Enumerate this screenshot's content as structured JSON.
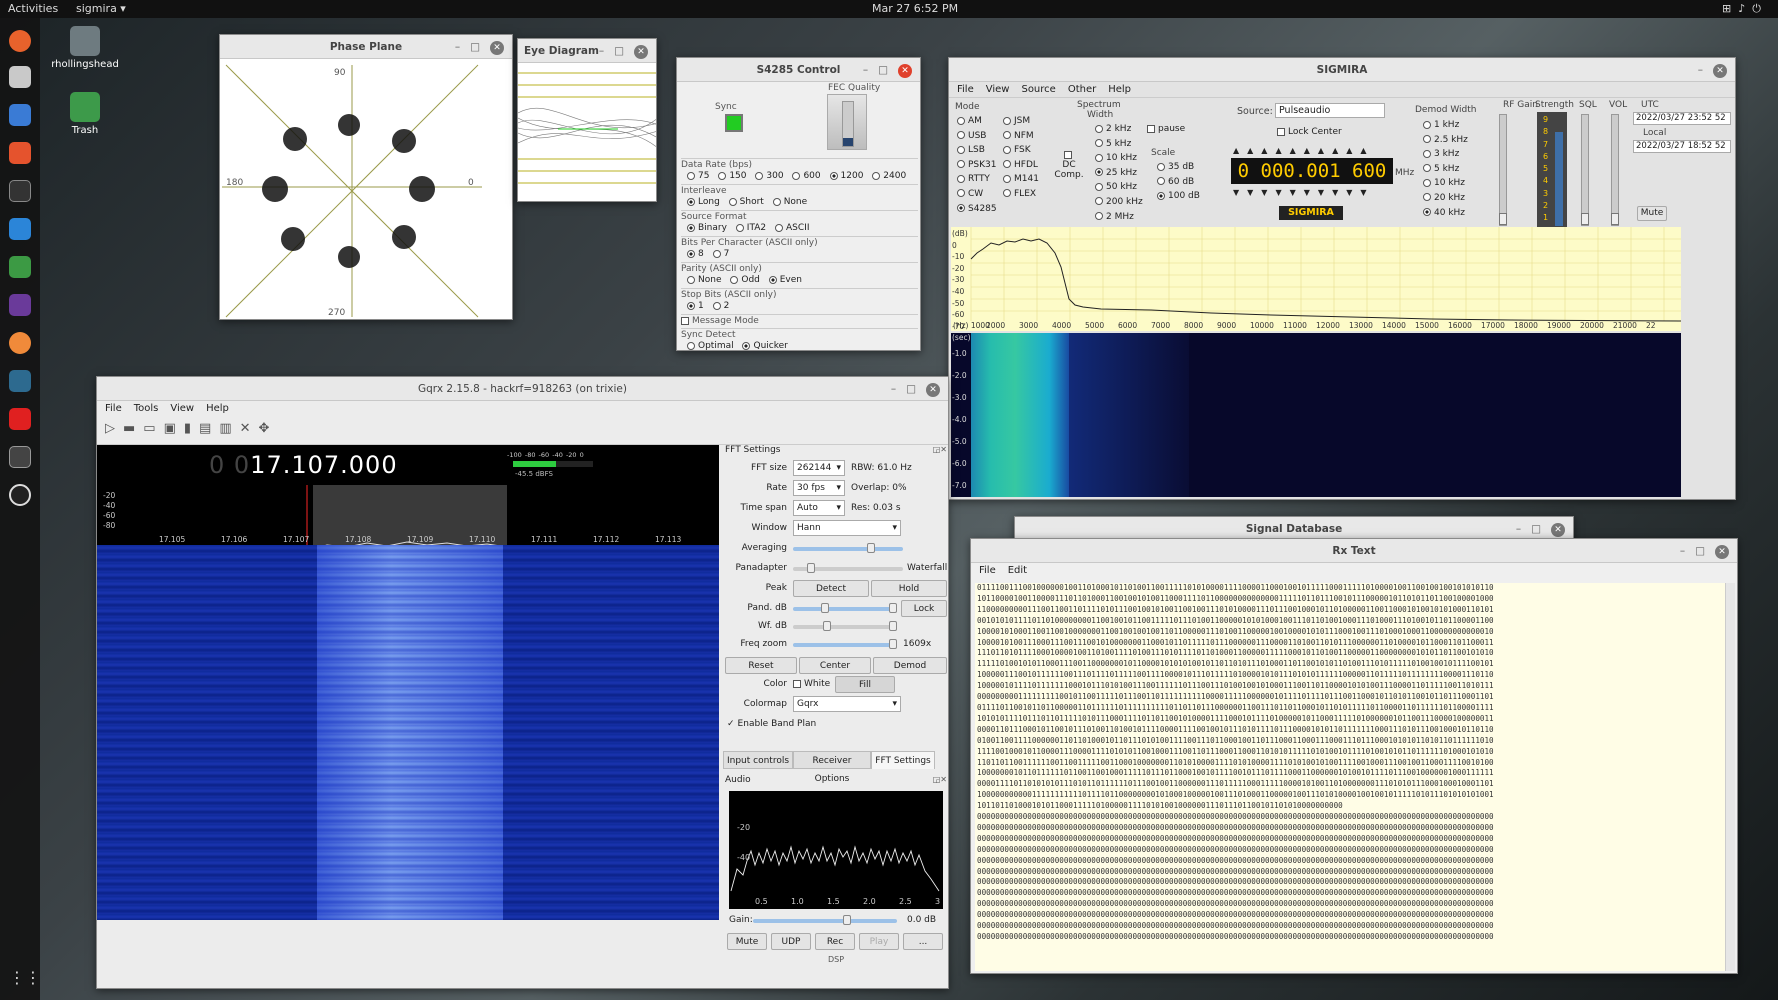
{
  "topbar": {
    "activities": "Activities",
    "app_name": "sigmira ▾",
    "clock": "Mar 27   6:52 PM"
  },
  "desktop": [
    {
      "label": "rhollingshead"
    },
    {
      "label": "Trash"
    }
  ],
  "phase_plane": {
    "title": "Phase Plane",
    "labels": {
      "top": "90",
      "left": "180",
      "right": "0",
      "bottom": "270"
    }
  },
  "eye_diagram": {
    "title": "Eye Diagram"
  },
  "s4285": {
    "title": "S4285 Control",
    "sync": "Sync",
    "fec": "FEC Quality",
    "data_rate": {
      "label": "Data Rate (bps)",
      "options": [
        "75",
        "150",
        "300",
        "600",
        "1200",
        "2400"
      ],
      "selected": "1200"
    },
    "interleave": {
      "label": "Interleave",
      "options": [
        "Long",
        "Short",
        "None"
      ],
      "selected": "Long"
    },
    "source_format": {
      "label": "Source Format",
      "options": [
        "Binary",
        "ITA2",
        "ASCII"
      ],
      "selected": "Binary"
    },
    "bits_per_char": {
      "label": "Bits Per Character  (ASCII only)",
      "options": [
        "8",
        "7"
      ],
      "selected": "8"
    },
    "parity": {
      "label": "Parity  (ASCII only)",
      "options": [
        "None",
        "Odd",
        "Even"
      ],
      "selected": "Even"
    },
    "stop_bits": {
      "label": "Stop Bits  (ASCII only)",
      "options": [
        "1",
        "2"
      ],
      "selected": "1"
    },
    "message_mode": "Message Mode",
    "sync_detect": {
      "label": "Sync Detect",
      "options": [
        "Optimal",
        "Quicker"
      ],
      "selected": "Quicker"
    }
  },
  "sigmira": {
    "title": "SIGMIRA",
    "menu": [
      "File",
      "View",
      "Source",
      "Other",
      "Help"
    ],
    "mode": {
      "label": "Mode",
      "col1": [
        "AM",
        "USB",
        "LSB",
        "PSK31",
        "RTTY",
        "CW",
        "S4285"
      ],
      "col2": [
        "JSM",
        "NFM",
        "FSK",
        "HFDL",
        "M141",
        "FLEX"
      ],
      "selected": "S4285"
    },
    "spectrum": {
      "label": "Spectrum",
      "width_label": "Width",
      "widths": [
        "2 kHz",
        "5 kHz",
        "10 kHz",
        "25 kHz",
        "50 kHz",
        "200 kHz",
        "2 MHz"
      ],
      "selected": "25 kHz",
      "pause": "pause",
      "dc_comp": "DC Comp.",
      "scale_label": "Scale",
      "scales": [
        "35 dB",
        "60 dB",
        "100 dB"
      ],
      "scale_selected": "100 dB"
    },
    "source_label": "Source:",
    "source_value": "Pulseaudio",
    "lock_center": "Lock Center",
    "frequency": "0 000.001 600",
    "freq_unit": "MHz",
    "brand": "SIGMIRA",
    "demod_width": {
      "label": "Demod Width",
      "options": [
        "1 kHz",
        "2.5 kHz",
        "3 kHz",
        "5 kHz",
        "10 kHz",
        "20 kHz",
        "40 kHz"
      ],
      "selected": "40 kHz"
    },
    "rf_gain": "RF Gain",
    "strength": "Strength",
    "strength_ticks": [
      "9",
      "8",
      "7",
      "6",
      "5",
      "4",
      "3",
      "2",
      "1"
    ],
    "sql": "SQL",
    "vol": "VOL",
    "utc_label": "UTC",
    "utc_value": "2022/03/27  23:52 52",
    "local_label": "Local",
    "local_value": "2022/03/27  18:52 52",
    "mute": "Mute",
    "spectrum_y": [
      "0",
      "-10",
      "-20",
      "-30",
      "-40",
      "-50",
      "-60",
      "-70"
    ],
    "spectrum_x": [
      "(Hz) 1000",
      "2000",
      "3000",
      "4000",
      "5000",
      "6000",
      "7000",
      "8000",
      "9000",
      "10000",
      "11000",
      "12000",
      "13000",
      "14000",
      "15000",
      "16000",
      "17000",
      "18000",
      "19000",
      "20000",
      "21000",
      "22"
    ],
    "db_label": "(dB)",
    "wf_y_label": "(sec)",
    "wf_y": [
      "-1.0",
      "-2.0",
      "-3.0",
      "-4.0",
      "-5.0",
      "-6.0",
      "-7.0"
    ]
  },
  "gqrx": {
    "title": "Gqrx 2.15.8 - hackrf=918263 (on trixie)",
    "menu": [
      "File",
      "Tools",
      "View",
      "Help"
    ],
    "freq_dim": "0 0",
    "freq": "17.107.000",
    "smeter_ticks": [
      "-100",
      "-80",
      "-60",
      "-40",
      "-20",
      "0"
    ],
    "dbfs": "-45.5 dBFS",
    "y_ticks": [
      "-20",
      "-40",
      "-60",
      "-80"
    ],
    "x_ticks": [
      "17.105",
      "17.106",
      "17.107",
      "17.108",
      "17.109",
      "17.110",
      "17.111",
      "17.112",
      "17.113"
    ],
    "fft": {
      "title": "FFT Settings",
      "fft_size_label": "FFT size",
      "fft_size": "262144",
      "rbw": "RBW: 61.0 Hz",
      "rate_label": "Rate",
      "rate": "30 fps",
      "overlap": "Overlap: 0%",
      "timespan_label": "Time span",
      "timespan": "Auto",
      "res": "Res: 0.03 s",
      "window_label": "Window",
      "window": "Hann",
      "averaging_label": "Averaging",
      "panadapter_label": "Panadapter",
      "waterfall_label": "Waterfall",
      "peak_label": "Peak",
      "detect": "Detect",
      "hold": "Hold",
      "pand_db_label": "Pand. dB",
      "lock": "Lock",
      "wf_db_label": "Wf. dB",
      "freq_zoom_label": "Freq zoom",
      "freq_zoom": "1609x",
      "reset": "Reset",
      "center": "Center",
      "demod": "Demod",
      "color_label": "Color",
      "white": "White",
      "fill": "Fill",
      "colormap_label": "Colormap",
      "colormap": "Gqrx",
      "band_plan": "Enable Band Plan"
    },
    "tabs": [
      "Input controls",
      "Receiver Options",
      "FFT Settings"
    ],
    "audio": {
      "title": "Audio",
      "y": [
        "-20",
        "-40"
      ],
      "x": [
        "0.5",
        "1.0",
        "1.5",
        "2.0",
        "2.5",
        "3"
      ],
      "gain_label": "Gain:",
      "gain_value": "0.0 dB",
      "buttons": [
        "Mute",
        "UDP",
        "Rec",
        "Play",
        "..."
      ],
      "dsp": "DSP"
    }
  },
  "signal_db": {
    "title": "Signal Database"
  },
  "rxtext": {
    "title": "Rx Text",
    "menu": [
      "File",
      "Edit"
    ],
    "lines": [
      "01111001110010000001001101000101101001100111110101000011110000110001001011111000111110100001001100100100101010110",
      "10110000100110000111011010001100100101001100011110110000000000000011111011011100101110000010110101101100100001000",
      "11000000000111001100110111101011100100101001100100111010100001110111001000101101000001100110001010010101000110101",
      "00101010111101101000000001100100101100111110111010011000001010100010011101101001000111010001110100101101100001100",
      "10000101000110011001000000011001001001001101100000111010011000001001000010101110001001110100010001100000000000010",
      "10000101001110001110011100101000000011000101101111101110000001110000110100110101110000001101000010110001101100011",
      "11101101011110001000010011010011110100111010111101101000110000011111000101101001100000110000000010101101100101010",
      "11111010010101100011100110000000101100001010101001011011010111010001101100101011010011101011111010010010111100101",
      "10000011100101111110011101111011111001111000010111011111010000101011101010111111000001101111101111111100001110110",
      "10000010111101111111000101110101001110011111101110011101001001010001110011011000010101001110000110111110011010111",
      "00000000011111111100101100111110111001101111111111000011111000000101111011110111001100010110101100101101110001101",
      "01111011001011011000001101111110111111111101101101110000001100111011011000101101011111011000011011111101100001111",
      "10101011110111011011111010111000111101101100101000011110001011110100000101100011111010000001011001110000100000011",
      "00001101110001011001011101001101001011110000111100100101110101111011100001010110111111100011101011100100010110110",
      "01001100111100000011011010001011011101010011110011101100010011011100011000111000111011100010101011010110111111010",
      "11110010001011000011100001111010101100100011100110111000110001101010111110101001011110100101011011111101000101010",
      "11011011001111110011001111100110001000000011010100001111010100001111010100101001111001000111001001100011110010100",
      "10000000101101111110110011001000111110111011000100101111001011101111000110000001010010111101110010000001000111111",
      "00001111011010101011101011011111101110010011000000111011111000111110000101001101000000011101010111000100010001101",
      "10000000000011111111111011110110000000010100010000010011101000110000010011101010000100100101111101011101010101001",
      "10110110100010101100011111010000011110101001000000111011101100101101010000000000",
      "00000000000000000000000000000000000000000000000000000000000000000000000000000000000000000000000000000000000000000",
      "00000000000000000000000000000000000000000000000000000000000000000000000000000000000000000000000000000000000000000",
      "00000000000000000000000000000000000000000000000000000000000000000000000000000000000000000000000000000000000000000",
      "00000000000000000000000000000000000000000000000000000000000000000000000000000000000000000000000000000000000000000",
      "00000000000000000000000000000000000000000000000000000000000000000000000000000000000000000000000000000000000000000",
      "00000000000000000000000000000000000000000000000000000000000000000000000000000000000000000000000000000000000000000",
      "00000000000000000000000000000000000000000000000000000000000000000000000000000000000000000000000000000000000000000",
      "00000000000000000000000000000000000000000000000000000000000000000000000000000000000000000000000000000000000000000",
      "00000000000000000000000000000000000000000000000000000000000000000000000000000000000000000000000000000000000000000",
      "00000000000000000000000000000000000000000000000000000000000000000000000000000000000000000000000000000000000000000",
      "00000000000000000000000000000000000000000000000000000000000000000000000000000000000000000000000000000000000000000",
      "00000000000000000000000000000000000000000000000000000000000000000000000000000000000000000000000000000000000000000"
    ]
  },
  "colors": {
    "accent_green": "#22cc22",
    "freq_yellow": "#ffcc00",
    "waterfall_blue": "#1a2fa0",
    "waterfall_cyan": "#1ee0e0"
  }
}
